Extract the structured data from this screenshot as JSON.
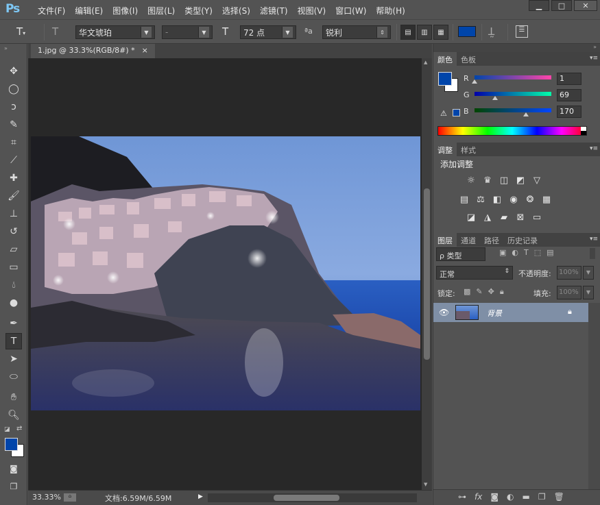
{
  "app": {
    "logo": "Ps"
  },
  "menu": [
    "文件(F)",
    "编辑(E)",
    "图像(I)",
    "图层(L)",
    "类型(Y)",
    "选择(S)",
    "滤镜(T)",
    "视图(V)",
    "窗口(W)",
    "帮助(H)"
  ],
  "window_controls": {
    "minimize": "▁",
    "maximize": "□",
    "close": "✕"
  },
  "options": {
    "font_family": "华文琥珀",
    "font_style": "-",
    "font_size": "72 点",
    "aa_label": "ªa",
    "antialias": "锐利",
    "text_color": "#0045aa"
  },
  "document": {
    "tab_title": "1.jpg @ 33.3%(RGB/8#) *",
    "tab_close": "×",
    "zoom": "33.33%",
    "doc_size": "文档:6.59M/6.59M"
  },
  "colors": {
    "foreground": "#0045aa",
    "background": "#ffffff"
  },
  "color_panel": {
    "tabs": [
      "颜色",
      "色板"
    ],
    "active_tab": "颜色",
    "channels": [
      {
        "label": "R",
        "value": "1",
        "fraction": 0.004
      },
      {
        "label": "G",
        "value": "69",
        "fraction": 0.27
      },
      {
        "label": "B",
        "value": "170",
        "fraction": 0.667
      }
    ]
  },
  "adjust_panel": {
    "tabs": [
      "调整",
      "样式"
    ],
    "active_tab": "调整",
    "heading": "添加调整"
  },
  "layers_panel": {
    "tabs": [
      "图层",
      "通道",
      "路径",
      "历史记录"
    ],
    "active_tab": "图层",
    "filter_label": "ρ 类型",
    "blend_mode": "正常",
    "opacity_label": "不透明度:",
    "opacity_value": "100%",
    "lock_label": "锁定:",
    "fill_label": "填充:",
    "fill_value": "100%",
    "layers": [
      {
        "name": "背景",
        "visible": true,
        "locked": true
      }
    ]
  }
}
